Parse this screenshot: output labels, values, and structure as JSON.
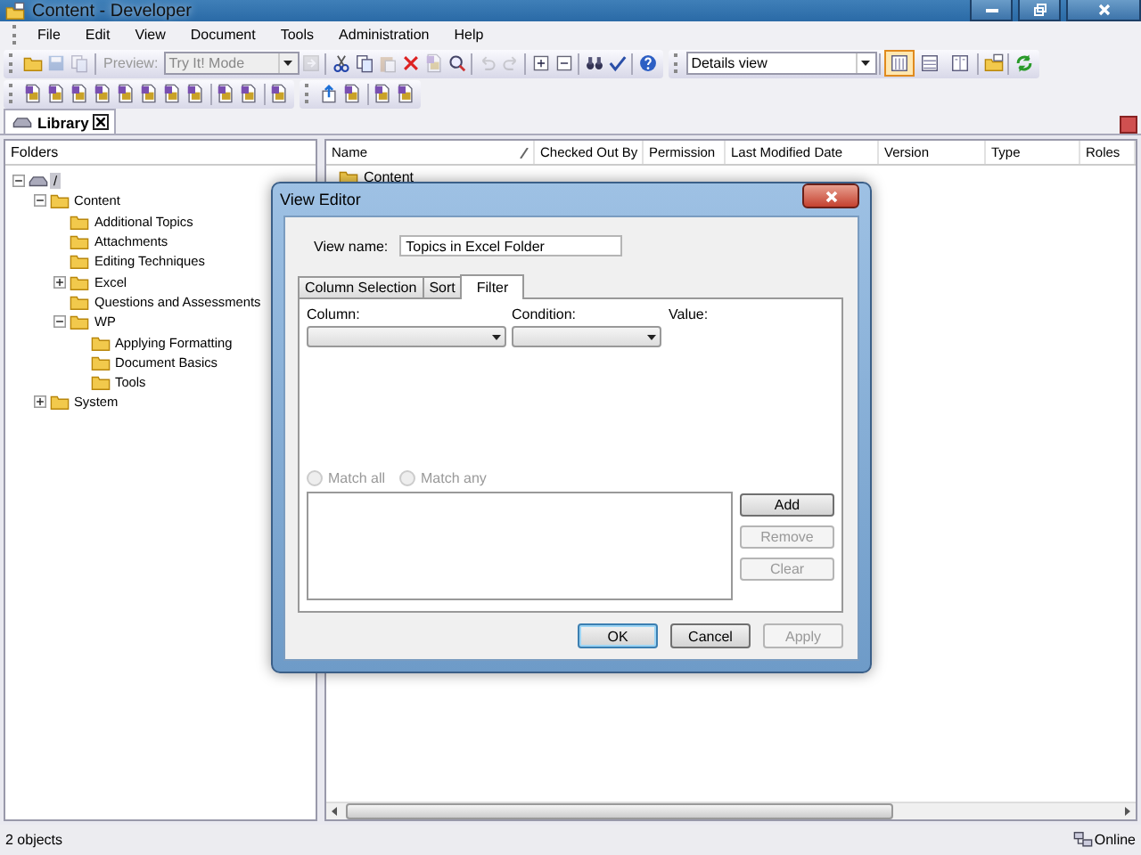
{
  "window": {
    "title": "Content - Developer"
  },
  "menu": [
    "File",
    "Edit",
    "View",
    "Document",
    "Tools",
    "Administration",
    "Help"
  ],
  "toolbar": {
    "buttons": [
      {
        "disabled": false
      },
      {
        "disabled": true
      },
      {
        "disabled": true
      },
      {
        "disabled": true
      },
      {
        "disabled": false
      },
      {
        "disabled": false
      },
      {
        "disabled": true
      },
      {
        "disabled": false
      },
      {
        "disabled": true
      },
      {
        "disabled": false
      },
      {
        "disabled": true
      },
      {
        "disabled": true
      },
      {
        "disabled": false
      },
      {
        "disabled": false
      },
      {
        "disabled": false
      },
      {
        "disabled": false
      },
      {
        "disabled": false
      }
    ],
    "preview": {
      "label": "Preview:",
      "disabled": true
    },
    "mode_combo": {
      "value": "Try It! Mode",
      "disabled": true
    },
    "view_combo": {
      "value": "Details view"
    },
    "view_buttons": [
      {
        "selected": true
      },
      {
        "selected": false
      },
      {
        "selected": false
      }
    ]
  },
  "library_tab": {
    "label": "Library"
  },
  "folders": {
    "header": "Folders",
    "tree": [
      {
        "label": "/",
        "selected": true,
        "expanded": true,
        "children": [
          {
            "label": "Content",
            "selected": false,
            "expanded": true,
            "children": [
              {
                "label": "Additional Topics",
                "selected": false
              },
              {
                "label": "Attachments",
                "selected": false
              },
              {
                "label": "Editing Techniques",
                "selected": false
              },
              {
                "label": "Excel",
                "selected": false,
                "expanded": false
              },
              {
                "label": "Questions and Assessments",
                "selected": false
              },
              {
                "label": "WP",
                "selected": false,
                "expanded": true,
                "children": [
                  {
                    "label": "Applying Formatting",
                    "selected": false
                  },
                  {
                    "label": "Document Basics",
                    "selected": false
                  },
                  {
                    "label": "Tools",
                    "selected": false
                  }
                ]
              }
            ]
          },
          {
            "label": "System",
            "selected": false,
            "expanded": false
          }
        ]
      }
    ]
  },
  "table": {
    "columns": [
      "Name",
      "Checked Out By",
      "Permission",
      "Last Modified Date",
      "Version",
      "Type",
      "Roles"
    ],
    "rows": [
      {
        "name": "Content"
      }
    ]
  },
  "dialog": {
    "title": "View Editor",
    "view_name_label": "View name:",
    "view_name": "Topics in Excel Folder",
    "tabs": [
      {
        "label": "Column Selection",
        "selected": false
      },
      {
        "label": "Sort",
        "selected": false
      },
      {
        "label": "Filter",
        "selected": true
      }
    ],
    "column_label": "Column:",
    "condition_label": "Condition:",
    "value_label": "Value:",
    "radios": [
      {
        "label": "Match all",
        "checked": false,
        "disabled": true
      },
      {
        "label": "Match any",
        "checked": false,
        "disabled": true
      }
    ],
    "side_buttons": [
      {
        "label": "Add",
        "disabled": false
      },
      {
        "label": "Remove",
        "disabled": true
      },
      {
        "label": "Clear",
        "disabled": true
      }
    ],
    "footer_buttons": [
      {
        "label": "OK",
        "disabled": false,
        "default": true
      },
      {
        "label": "Cancel",
        "disabled": false,
        "default": false
      },
      {
        "label": "Apply",
        "disabled": true,
        "default": false
      }
    ]
  },
  "status_bar": {
    "count": "2 objects",
    "connection": "Online"
  }
}
